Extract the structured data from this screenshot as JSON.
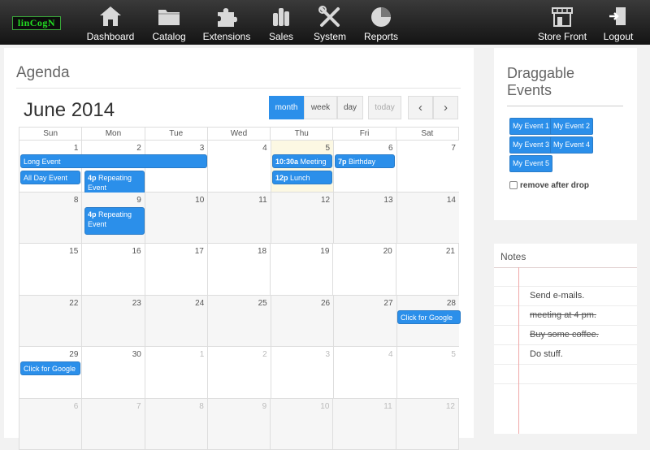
{
  "brand": {
    "logo_text": "linCogN"
  },
  "nav": {
    "items": [
      {
        "label": "Dashboard",
        "icon": "home-icon"
      },
      {
        "label": "Catalog",
        "icon": "folder-icon"
      },
      {
        "label": "Extensions",
        "icon": "puzzle-icon"
      },
      {
        "label": "Sales",
        "icon": "coins-icon"
      },
      {
        "label": "System",
        "icon": "tools-icon"
      },
      {
        "label": "Reports",
        "icon": "pie-chart-icon"
      }
    ],
    "right": [
      {
        "label": "Store Front",
        "icon": "store-icon"
      },
      {
        "label": "Logout",
        "icon": "logout-icon"
      }
    ]
  },
  "agenda": {
    "title": "Agenda",
    "month_title": "June 2014",
    "views": {
      "month": "month",
      "week": "week",
      "day": "day",
      "today": "today"
    },
    "prev": "‹",
    "next": "›",
    "weekdays": [
      "Sun",
      "Mon",
      "Tue",
      "Wed",
      "Thu",
      "Fri",
      "Sat"
    ],
    "weeks": [
      [
        "1",
        "2",
        "3",
        "4",
        "5",
        "6",
        "7"
      ],
      [
        "8",
        "9",
        "10",
        "11",
        "12",
        "13",
        "14"
      ],
      [
        "15",
        "16",
        "17",
        "18",
        "19",
        "20",
        "21"
      ],
      [
        "22",
        "23",
        "24",
        "25",
        "26",
        "27",
        "28"
      ],
      [
        "29",
        "30",
        "1",
        "2",
        "3",
        "4",
        "5"
      ],
      [
        "6",
        "7",
        "8",
        "9",
        "10",
        "11",
        "12"
      ]
    ],
    "events": {
      "long_event": "Long Event",
      "all_day": "All Day Event",
      "repeating1_time": "4p",
      "repeating1_title": "Repeating Event",
      "meeting_time": "10:30a",
      "meeting_title": "Meeting",
      "lunch_time": "12p",
      "lunch_title": "Lunch",
      "birthday_time": "7p",
      "birthday_title": "Birthday Party",
      "repeating2_time": "4p",
      "repeating2_title": "Repeating Event",
      "google1": "Click for Google",
      "google2": "Click for Google"
    }
  },
  "draggable": {
    "title": "Draggable Events",
    "events": [
      "My Event 1",
      "My Event 2",
      "My Event 3",
      "My Event 4",
      "My Event 5"
    ],
    "remove_label": "remove after drop",
    "remove_checked": false
  },
  "notes": {
    "title": "Notes",
    "items": [
      {
        "text": "Send e-mails.",
        "done": false
      },
      {
        "text": "meeting at 4 pm.",
        "done": true
      },
      {
        "text": "Buy some coffee.",
        "done": true
      },
      {
        "text": "Do stuff.",
        "done": false
      }
    ]
  },
  "colors": {
    "accent": "#2b8fea",
    "today": "#fcf8e3",
    "nav_bg": "#1e1e1e"
  }
}
